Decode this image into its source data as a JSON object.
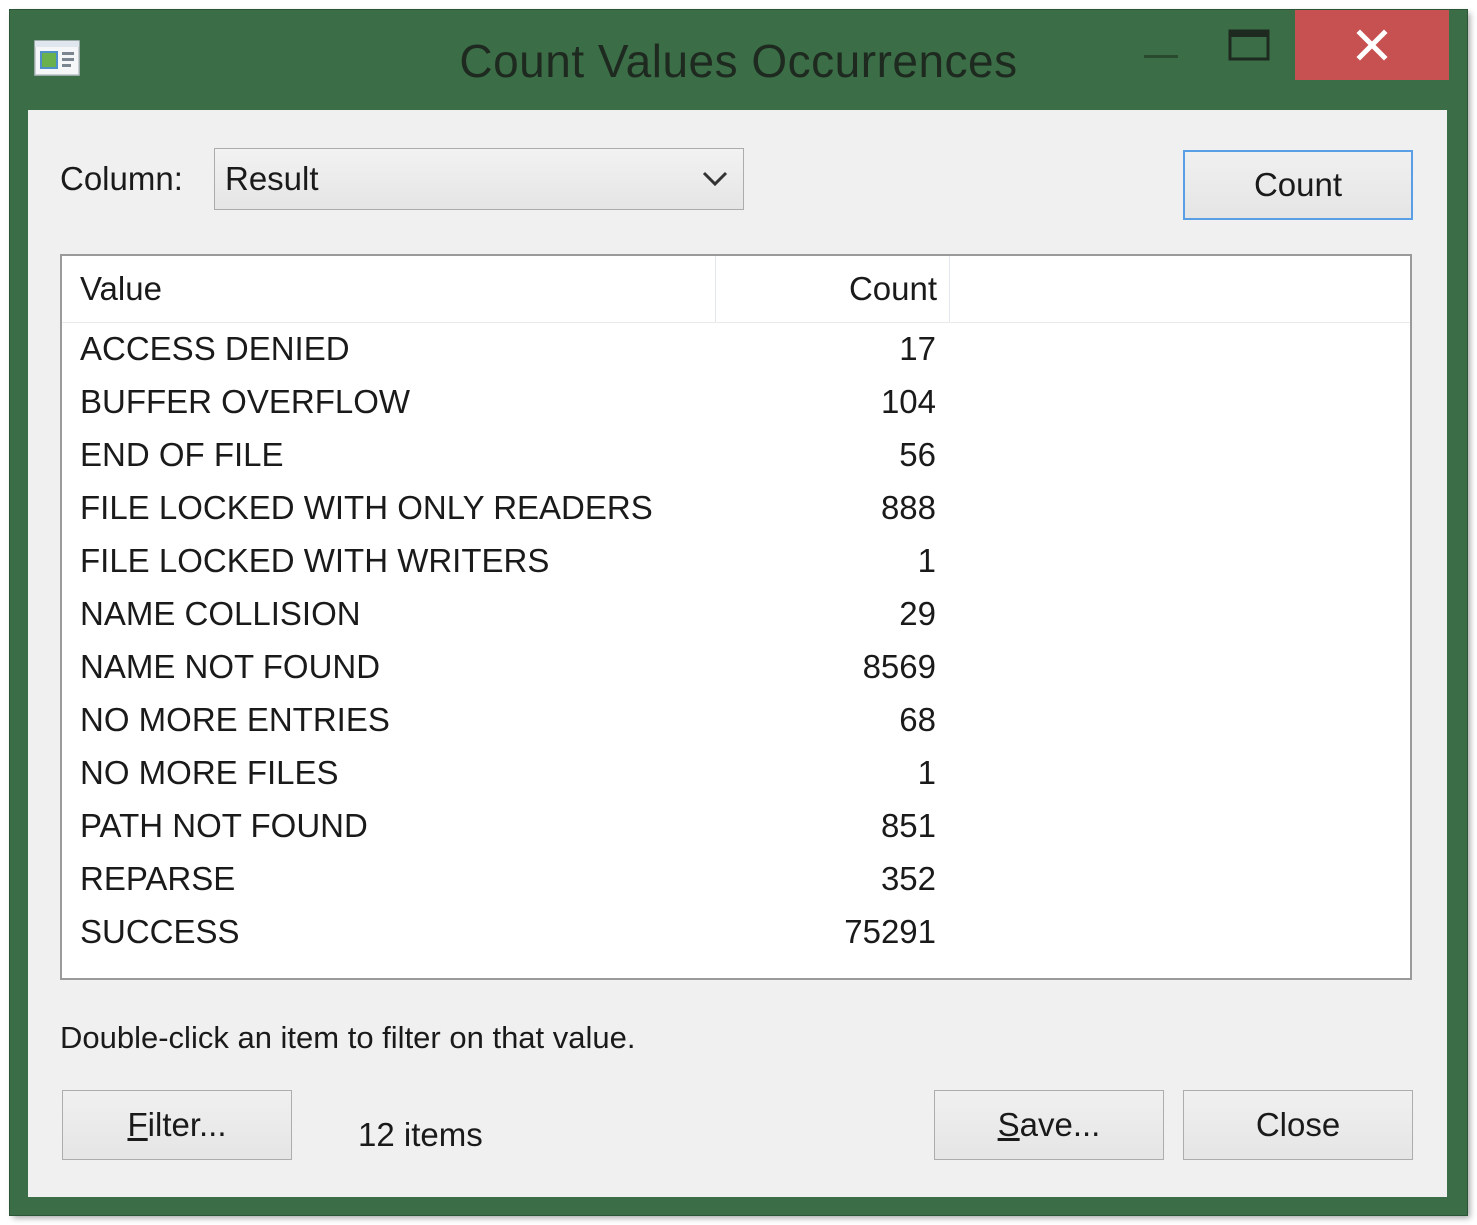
{
  "window": {
    "title": "Count Values Occurrences",
    "close_glyph": "✕"
  },
  "column": {
    "label": "Column:",
    "selected": "Result"
  },
  "buttons": {
    "count": "Count",
    "filter_mnemonic": "F",
    "filter_rest": "ilter...",
    "save_mnemonic": "S",
    "save_rest": "ave...",
    "close": "Close"
  },
  "table": {
    "headers": {
      "value": "Value",
      "count": "Count"
    },
    "rows": [
      {
        "value": "ACCESS DENIED",
        "count": "17"
      },
      {
        "value": "BUFFER OVERFLOW",
        "count": "104"
      },
      {
        "value": "END OF FILE",
        "count": "56"
      },
      {
        "value": "FILE LOCKED WITH ONLY READERS",
        "count": "888"
      },
      {
        "value": "FILE LOCKED WITH WRITERS",
        "count": "1"
      },
      {
        "value": "NAME COLLISION",
        "count": "29"
      },
      {
        "value": "NAME NOT FOUND",
        "count": "8569"
      },
      {
        "value": "NO MORE ENTRIES",
        "count": "68"
      },
      {
        "value": "NO MORE FILES",
        "count": "1"
      },
      {
        "value": "PATH NOT FOUND",
        "count": "851"
      },
      {
        "value": "REPARSE",
        "count": "352"
      },
      {
        "value": "SUCCESS",
        "count": "75291"
      }
    ]
  },
  "hint": "Double-click an item to filter on that value.",
  "status": {
    "items": "12 items"
  },
  "icons": {
    "app": "app-window-icon",
    "minimize": "minimize-icon",
    "maximize": "maximize-icon",
    "close": "close-icon",
    "dropdown": "chevron-down-icon"
  },
  "colors": {
    "frame": "#3b6d47",
    "close_button": "#c75050",
    "client": "#f0f0f0",
    "default_button_border": "#5a9ee6"
  }
}
